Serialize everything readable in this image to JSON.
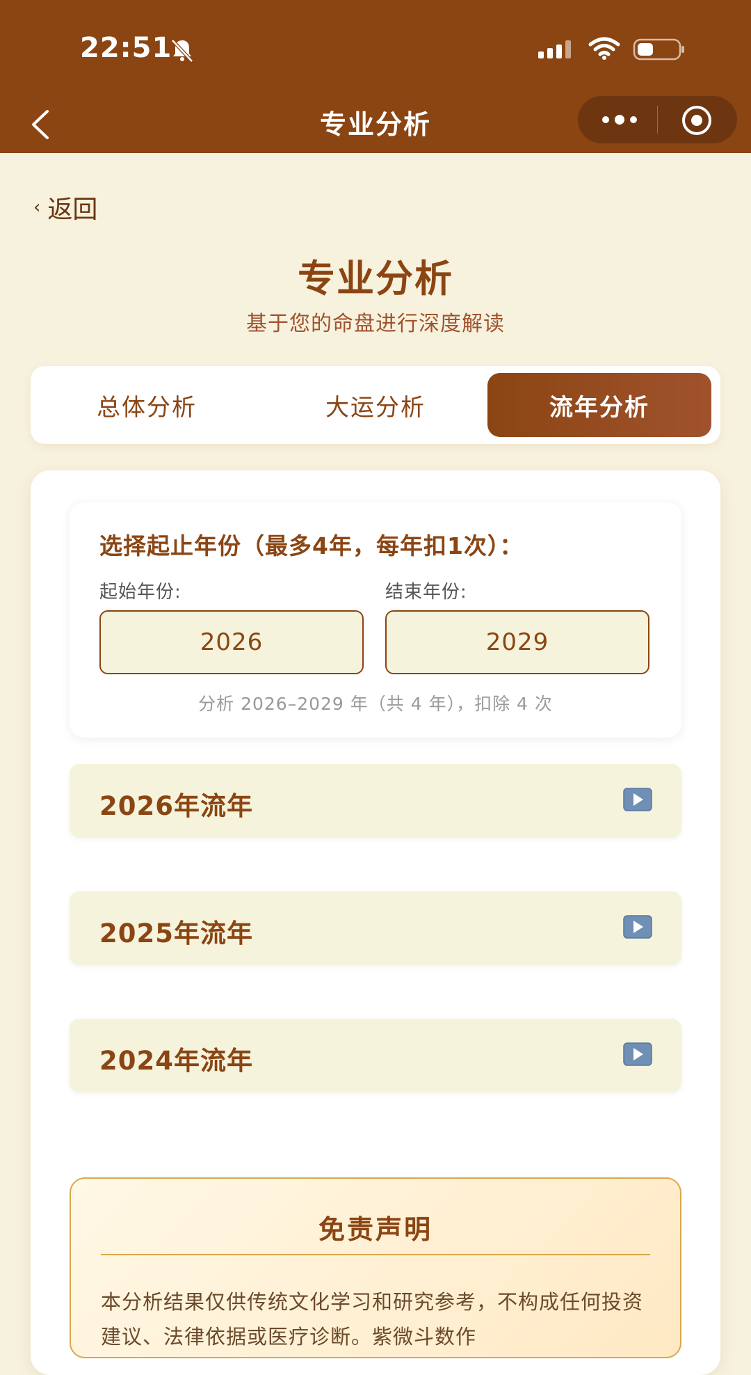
{
  "status_bar": {
    "time": "22:51"
  },
  "nav": {
    "title": "专业分析"
  },
  "back_label": "返回",
  "header": {
    "title": "专业分析",
    "subtitle": "基于您的命盘进行深度解读"
  },
  "tabs": [
    {
      "label": "总体分析",
      "active": false
    },
    {
      "label": "大运分析",
      "active": false
    },
    {
      "label": "流年分析",
      "active": true
    }
  ],
  "range": {
    "title": "选择起止年份（最多4年，每年扣1次）：",
    "start_label": "起始年份:",
    "end_label": "结束年份:",
    "start_value": "2026",
    "end_value": "2029",
    "note": "分析 2026–2029 年（共 4 年），扣除 4 次"
  },
  "year_items": [
    {
      "label": "2026年流年",
      "icon": "play-icon"
    },
    {
      "label": "2025年流年",
      "icon": "play-icon"
    },
    {
      "label": "2024年流年",
      "icon": "play-icon"
    }
  ],
  "disclaimer": {
    "title": "免责声明",
    "text": "本分析结果仅供传统文化学习和研究参考，不构成任何投资建议、法律依据或医疗诊断。紫微斗数作"
  },
  "colors": {
    "brand": "#8b4513",
    "background": "#f7f2de",
    "field_bg": "#f5f3dc",
    "accent_border": "#d9a84a"
  }
}
